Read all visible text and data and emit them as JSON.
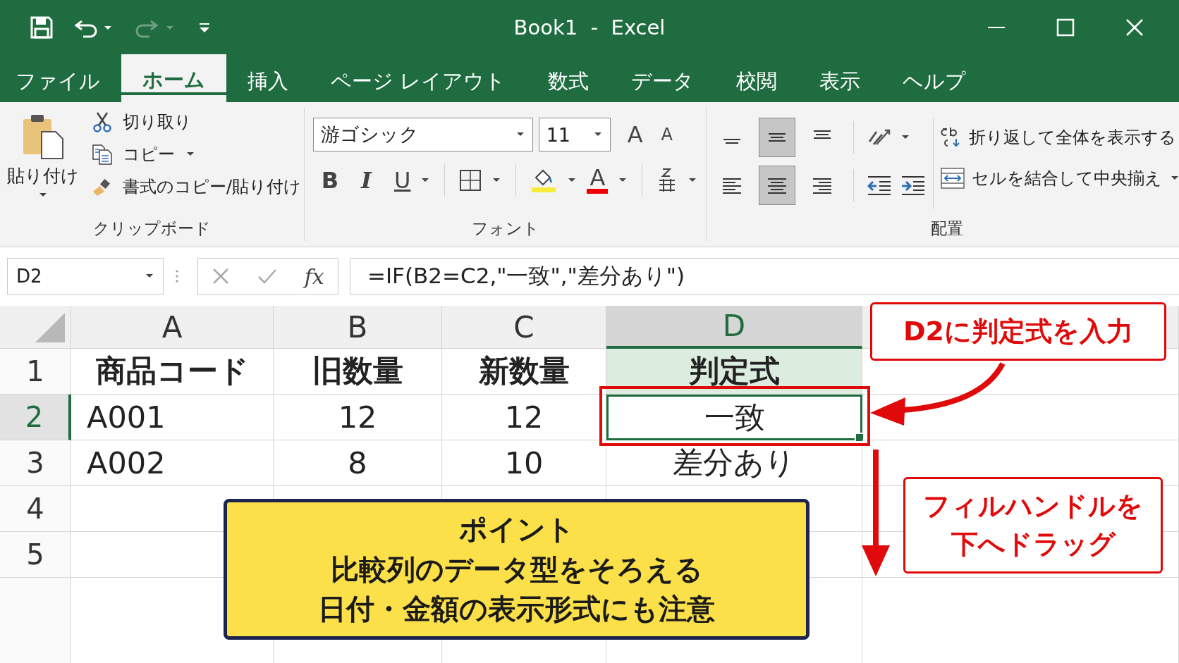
{
  "window": {
    "title": "Book1  -  Excel"
  },
  "tabs": [
    {
      "label": "ファイル",
      "selected": false
    },
    {
      "label": "ホーム",
      "selected": true
    },
    {
      "label": "挿入",
      "selected": false
    },
    {
      "label": "ページ レイアウト",
      "selected": false
    },
    {
      "label": "数式",
      "selected": false
    },
    {
      "label": "データ",
      "selected": false
    },
    {
      "label": "校閲",
      "selected": false
    },
    {
      "label": "表示",
      "selected": false
    },
    {
      "label": "ヘルプ",
      "selected": false
    }
  ],
  "ribbon": {
    "clipboard": {
      "paste": "貼り付け",
      "cut": "切り取り",
      "copy": "コピー",
      "format_painter": "書式のコピー/貼り付け",
      "label": "クリップボード"
    },
    "font": {
      "name": "游ゴシック",
      "size": "11",
      "grow": "A",
      "shrink": "A",
      "bold": "B",
      "italic": "I",
      "underline": "U",
      "font_color": "A",
      "label": "フォント"
    },
    "alignment": {
      "vertical": [
        {
          "selected": false
        },
        {
          "selected": true
        },
        {
          "selected": false
        }
      ],
      "horizontal": [
        {
          "selected": false
        },
        {
          "selected": true
        },
        {
          "selected": false
        }
      ],
      "wrap_text": "折り返して全体を表示する",
      "merge": "セルを結合して中央揃え",
      "label": "配置"
    }
  },
  "formula_bar": {
    "name_box": "D2",
    "function_label": "fx",
    "formula": "=IF(B2=C2,\"一致\",\"差分あり\")"
  },
  "sheet": {
    "columns": [
      {
        "label": "A",
        "selected": false
      },
      {
        "label": "B",
        "selected": false
      },
      {
        "label": "C",
        "selected": false
      },
      {
        "label": "D",
        "selected": true
      }
    ],
    "rows": [
      {
        "label": "1",
        "selected": false,
        "bold": true,
        "cells": [
          {
            "text": "商品コード",
            "highlighted": false,
            "active": false
          },
          {
            "text": "旧数量",
            "highlighted": false,
            "active": false
          },
          {
            "text": "新数量",
            "highlighted": false,
            "active": false
          },
          {
            "text": "判定式",
            "highlighted": true,
            "active": false
          }
        ]
      },
      {
        "label": "2",
        "selected": true,
        "bold": false,
        "cells": [
          {
            "text": "A001",
            "highlighted": false,
            "active": false
          },
          {
            "text": "12",
            "highlighted": false,
            "active": false
          },
          {
            "text": "12",
            "highlighted": false,
            "active": false
          },
          {
            "text": "一致",
            "highlighted": false,
            "active": true
          }
        ]
      },
      {
        "label": "3",
        "selected": false,
        "bold": false,
        "cells": [
          {
            "text": "A002",
            "highlighted": false,
            "active": false
          },
          {
            "text": "8",
            "highlighted": false,
            "active": false
          },
          {
            "text": "10",
            "highlighted": false,
            "active": false
          },
          {
            "text": "差分あり",
            "highlighted": false,
            "active": false
          }
        ]
      },
      {
        "label": "4",
        "selected": false,
        "cells": []
      },
      {
        "label": "5",
        "selected": false,
        "cells": []
      }
    ]
  },
  "callouts": [
    {
      "lines": [
        "D2に判定式を入力"
      ]
    },
    {
      "lines": [
        "フィルハンドルを",
        "下へドラッグ"
      ]
    }
  ],
  "note": {
    "title": "ポイント",
    "lines": [
      "比較列のデータ型をそろえる",
      "日付・金額の表示形式にも注意"
    ]
  }
}
